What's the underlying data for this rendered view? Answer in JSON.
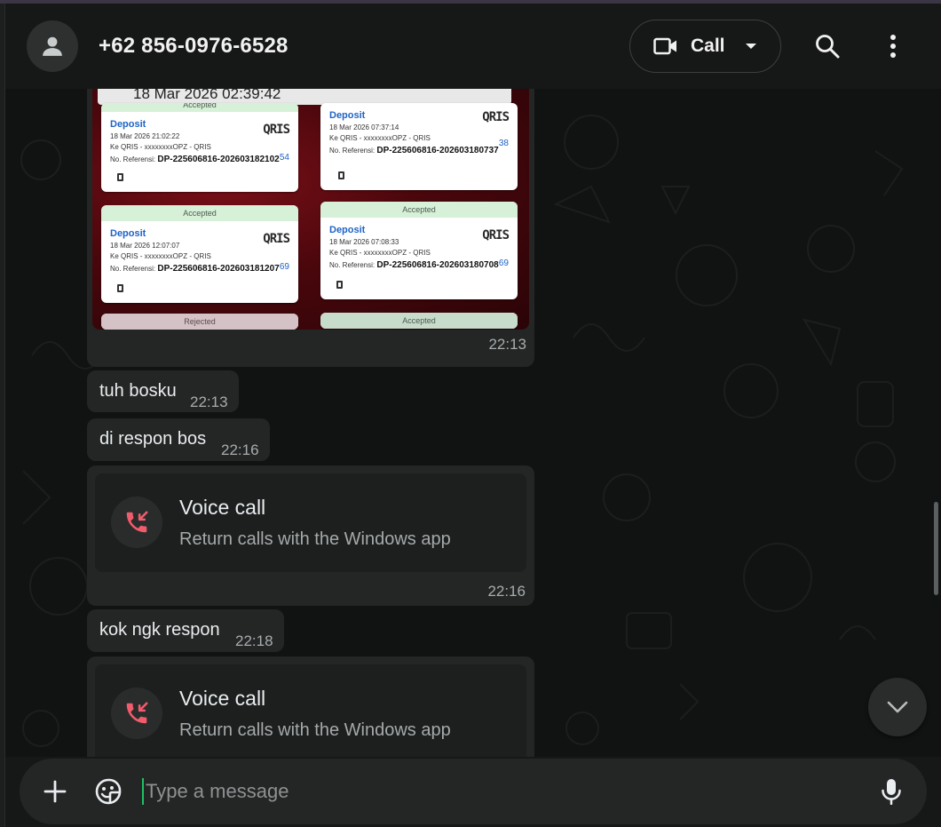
{
  "header": {
    "contact_name": "+62 856-0976-6528",
    "call_label": "Call",
    "icons": [
      "contact-avatar-icon",
      "video-camera-icon",
      "chevron-down-icon",
      "search-icon",
      "more-vertical-icon"
    ]
  },
  "messages": {
    "image_message": {
      "header_text": "18 Mar 2026 02:39:42",
      "time": "22:13",
      "cards": [
        {
          "status": "Accepted",
          "title": "Deposit",
          "date": "18 Mar 2026 21:02:22",
          "dest": "Ke QRIS - xxxxxxxxOPZ - QRIS",
          "amount": "54",
          "ref_label": "No. Referensi:",
          "ref": "DP-225606816-202603182102",
          "logo": "QRIS"
        },
        {
          "status": "",
          "title": "Deposit",
          "date": "18 Mar 2026 07:37:14",
          "dest": "Ke QRIS - xxxxxxxxOPZ - QRIS",
          "amount": "38",
          "ref_label": "No. Referensi:",
          "ref": "DP-225606816-202603180737",
          "logo": "QRIS"
        },
        {
          "status": "Accepted",
          "title": "Deposit",
          "date": "18 Mar 2026 12:07:07",
          "dest": "Ke QRIS - xxxxxxxxOPZ - QRIS",
          "amount": "69",
          "ref_label": "No. Referensi:",
          "ref": "DP-225606816-202603181207",
          "logo": "QRIS"
        },
        {
          "status": "Accepted",
          "title": "Deposit",
          "date": "18 Mar 2026 07:08:33",
          "dest": "Ke QRIS - xxxxxxxxOPZ - QRIS",
          "amount": "69",
          "ref_label": "No. Referensi:",
          "ref": "DP-225606816-202603180708",
          "logo": "QRIS"
        }
      ],
      "bottom_statuses": [
        "Rejected",
        "Accepted"
      ]
    },
    "text1": {
      "text": "tuh bosku",
      "time": "22:13"
    },
    "text2": {
      "text": "di respon bos",
      "time": "22:16"
    },
    "call1": {
      "title": "Voice call",
      "subtitle": "Return calls with the Windows app",
      "time": "22:16",
      "icon": "missed-call-icon"
    },
    "text3": {
      "text": "kok ngk respon",
      "time": "22:18"
    },
    "call2": {
      "title": "Voice call",
      "subtitle": "Return calls with the Windows app",
      "icon": "missed-call-icon"
    }
  },
  "composer": {
    "placeholder": "Type a message",
    "value": "",
    "icons": [
      "plus-icon",
      "sticker-icon",
      "microphone-icon"
    ]
  },
  "colors": {
    "background": "#161717",
    "bubble": "#242626",
    "missed_call": "#f15c6d",
    "accent": "#21c063"
  }
}
